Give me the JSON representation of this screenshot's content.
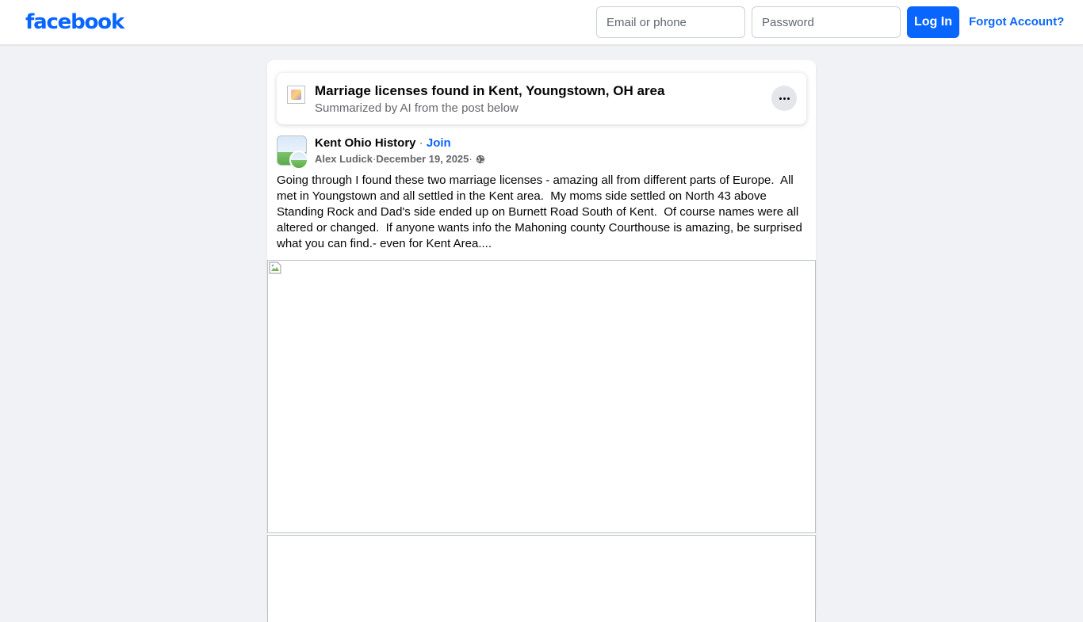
{
  "header": {
    "logo": "facebook",
    "email_placeholder": "Email or phone",
    "password_placeholder": "Password",
    "login_label": "Log In",
    "forgot_label": "Forgot Account?"
  },
  "summary": {
    "title": "Marriage licenses found in Kent, Youngstown, OH area",
    "subtitle": "Summarized by AI from the post below",
    "more_icon": "more-horizontal-icon"
  },
  "post": {
    "group_name": "Kent Ohio History",
    "separator": " · ",
    "join_label": "Join",
    "author": "Alex Ludick",
    "meta_separator": " · ",
    "date": "December 19, 2025",
    "audience_icon": "globe-icon",
    "text": "Going through I found these two marriage licenses - amazing all from different parts of Europe.  All met in Youngstown and all settled in the Kent area.  My moms side settled on North 43 above Standing Rock and Dad's side ended up on Burnett Road South of Kent.  Of course names were all altered or changed.  If anyone wants info the Mahoning county Courthouse is amazing, be surprised what you can find.- even for Kent Area...."
  },
  "colors": {
    "brand": "#0866ff",
    "background": "#f0f2f5",
    "secondary_text": "#65676b"
  }
}
